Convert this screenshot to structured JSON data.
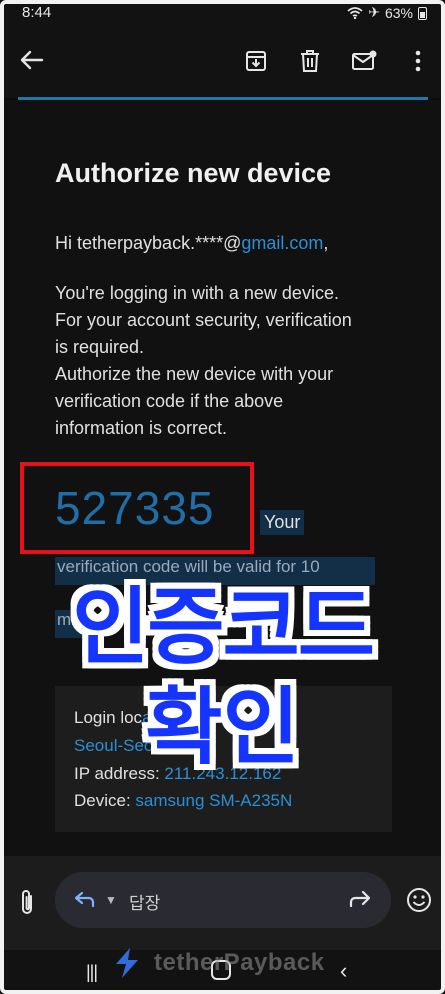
{
  "status": {
    "time": "8:44",
    "battery": "63%"
  },
  "toolbar": {
    "back_icon": "arrow-left-icon",
    "actions": [
      "archive-icon",
      "trash-icon",
      "mark-unread-icon",
      "more-vert-icon"
    ]
  },
  "email": {
    "title": "Authorize new device",
    "greeting_prefix": "Hi tetherpayback.****@",
    "greeting_link": "gmail.com",
    "greeting_suffix": ",",
    "paragraph_lines": [
      "You're logging in with a new device.",
      "For your account security, verification",
      "is required.",
      "Authorize the new device with your",
      "verification code if the above",
      "information is correct."
    ],
    "code": "527335",
    "code_after": "Your",
    "validity_partial": "verification code will be valid for 10",
    "validity_partial_2": "m",
    "login_location_label": "Login loc",
    "login_location_partial": "ati",
    "login_location_value": "Seoul-Seoul",
    "ip_label": "IP address: ",
    "ip_value": "211.243.12.162",
    "device_label": "Device: ",
    "device_value": "samsung SM-A235N"
  },
  "overlay": {
    "line1": "인증코드",
    "line2": "확인"
  },
  "reply_bar": {
    "reply_label": "답장"
  },
  "watermark": {
    "text": "tetherPayback"
  },
  "colors": {
    "link": "#2b8fd6",
    "highlight": "#e8101a",
    "overlay": "#1535ff",
    "divider": "#1f78a8"
  }
}
